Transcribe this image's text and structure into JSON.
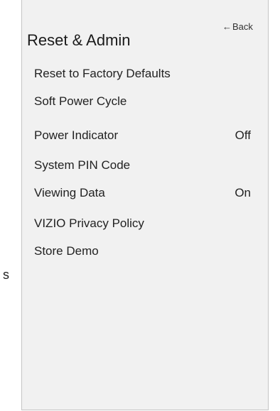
{
  "panel": {
    "title": "Reset & Admin",
    "back_arrow": "←",
    "back_label": "Back"
  },
  "menu": {
    "items": [
      {
        "label": "Reset to Factory Defaults",
        "value": ""
      },
      {
        "label": "Soft Power Cycle",
        "value": ""
      },
      {
        "label": "Power Indicator",
        "value": "Off"
      },
      {
        "label": "System PIN Code",
        "value": ""
      },
      {
        "label": "Viewing Data",
        "value": "On"
      },
      {
        "label": "VIZIO Privacy Policy",
        "value": ""
      },
      {
        "label": "Store Demo",
        "value": ""
      }
    ]
  },
  "background": {
    "edge_text": "s"
  }
}
